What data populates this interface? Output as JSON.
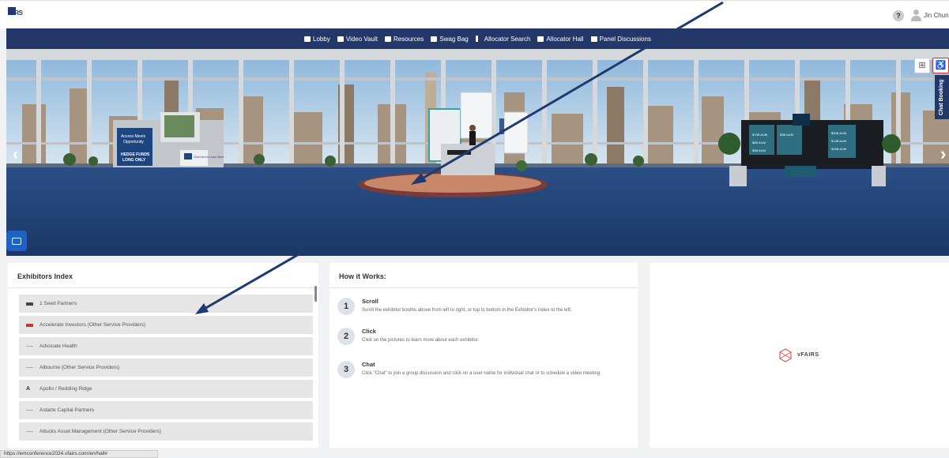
{
  "header": {
    "logo_text": "TRS",
    "help_label": "?",
    "user_name": "Jin Chun ▾"
  },
  "nav": {
    "items": [
      {
        "label": "Lobby"
      },
      {
        "label": "Video Vault"
      },
      {
        "label": "Resources"
      },
      {
        "label": "Swag Bag"
      },
      {
        "label": "Allocator Search"
      },
      {
        "label": "Allocator Hall"
      },
      {
        "label": "Panel Discussions"
      }
    ]
  },
  "hall": {
    "left_arrow": "‹",
    "right_arrow": "›",
    "grid_icon": "⊞",
    "access_icon": "♿",
    "chat_booking": "Chat Booking",
    "booth_left": {
      "line1": "Access Meets",
      "line2": "Opportunity",
      "line3": "HEDGE FUNDS",
      "line4": "LONG ONLY",
      "cta": "Click here to Learn More"
    },
    "booth_right": {
      "aum1": "$70B AUM",
      "aum2": "$6B AUM",
      "aum3": "$5B AUM",
      "aum4": "$3B AUM",
      "aum5": "$30B AUM",
      "aum6": "$13B AUM",
      "aum7": "$15B AUM"
    }
  },
  "exhibitors": {
    "title": "Exhibitors Index",
    "items": [
      {
        "name": "1 Seed Partners",
        "logo_color": "#444"
      },
      {
        "name": "Accelerate Investors (Other Service Providers)",
        "logo_color": "#c33"
      },
      {
        "name": "Advocate Health",
        "logo_color": "#aaa"
      },
      {
        "name": "Albourne (Other Service Providers)",
        "logo_color": "#aaa"
      },
      {
        "name": "Apollo / Redding Ridge",
        "logo_color": "#333"
      },
      {
        "name": "Astarte Capital Partners",
        "logo_color": "#aaa"
      },
      {
        "name": "Attucks Asset Management (Other Service Providers)",
        "logo_color": "#aaa"
      }
    ]
  },
  "how": {
    "title": "How it Works:",
    "steps": [
      {
        "num": "1",
        "title": "Scroll",
        "desc": "Scroll the exhibitor booths above from left to right, or top to bottom in the Exhibitor's Index to the left."
      },
      {
        "num": "2",
        "title": "Click",
        "desc": "Click on the pictures to learn more about each exhibitor."
      },
      {
        "num": "3",
        "title": "Chat",
        "desc": "Click \"Chat\" to join a group discussion and click on a user name for individual chat or to schedule a video meeting."
      }
    ]
  },
  "sponsor": {
    "name": "vFAIRS"
  },
  "status_bar": {
    "url": "https://emconference2024.vfairs.com/en/hall#"
  },
  "colors": {
    "navy": "#233869",
    "annotation_arrow": "#1e3a6e"
  }
}
